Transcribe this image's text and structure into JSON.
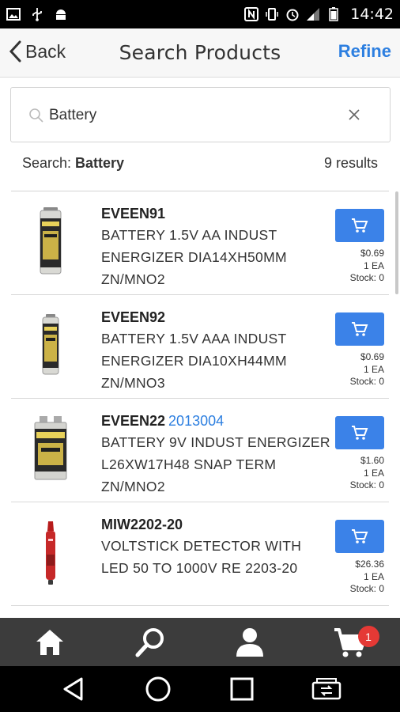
{
  "status_bar": {
    "time": "14:42",
    "left_icons": [
      "image-icon",
      "usb-icon",
      "android-icon"
    ],
    "right_icons": [
      "nfc-icon",
      "vibrate-icon",
      "alarm-icon",
      "signal-icon",
      "battery-icon"
    ]
  },
  "header": {
    "back_label": "Back",
    "title": "Search Products",
    "refine_label": "Refine"
  },
  "search": {
    "value": "Battery",
    "placeholder": ""
  },
  "summary": {
    "label": "Search: ",
    "term": "Battery",
    "count": "9 results"
  },
  "results": [
    {
      "sku": "EVEEN91",
      "alt_code": "",
      "desc": "BATTERY 1.5V AA INDUST ENERGIZER DIA14XH50MM ZN/MNO2",
      "price": "$0.69",
      "uom": "1 EA",
      "stock": "Stock: 0",
      "thumb": "aa-battery"
    },
    {
      "sku": "EVEEN92",
      "alt_code": "",
      "desc": "BATTERY 1.5V AAA INDUST ENERGIZER DIA10XH44MM ZN/MNO3",
      "price": "$0.69",
      "uom": "1 EA",
      "stock": "Stock: 0",
      "thumb": "aaa-battery"
    },
    {
      "sku": "EVEEN22",
      "alt_code": "2013004",
      "desc": "BATTERY 9V INDUST ENERGIZER L26XW17H48 SNAP TERM ZN/MNO2",
      "price": "$1.60",
      "uom": "1 EA",
      "stock": "Stock: 0",
      "thumb": "9v-battery"
    },
    {
      "sku": "MIW2202-20",
      "alt_code": "",
      "desc": "VOLTSTICK DETECTOR WITH LED 50 TO 1000V RE 2203-20",
      "price": "$26.36",
      "uom": "1 EA",
      "stock": "Stock: 0",
      "thumb": "voltstick"
    }
  ],
  "tabbar": {
    "tabs": [
      "home-icon",
      "search-icon",
      "account-icon",
      "cart-icon"
    ],
    "cart_badge": "1"
  },
  "colors": {
    "accent": "#2d7fe0",
    "cart_button": "#3b82e8",
    "tabbar": "#3c3c3c",
    "badge": "#e53935"
  }
}
